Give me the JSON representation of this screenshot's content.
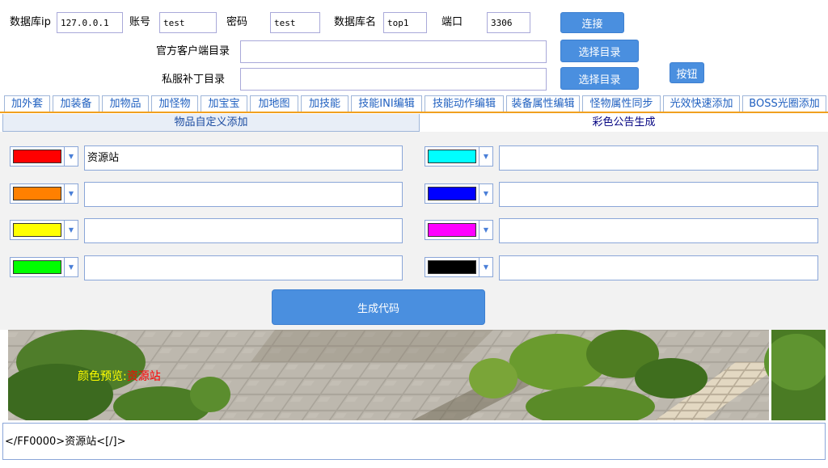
{
  "db": {
    "ip_label": "数据库ip",
    "ip_value": "127.0.0.1",
    "account_label": "账号",
    "account_value": "test",
    "password_label": "密码",
    "password_value": "test",
    "dbname_label": "数据库名",
    "dbname_value": "top1",
    "port_label": "端口",
    "port_value": "3306",
    "connect_button": "连接"
  },
  "dirs": {
    "official_label": "官方客户端目录",
    "official_value": "",
    "official_button": "选择目录",
    "private_label": "私服补丁目录",
    "private_value": "",
    "private_button": "选择目录",
    "extra_button": "按钮"
  },
  "tabs": [
    {
      "label": "加外套"
    },
    {
      "label": "加装备"
    },
    {
      "label": "加物品"
    },
    {
      "label": "加怪物"
    },
    {
      "label": "加宝宝"
    },
    {
      "label": "加地图"
    },
    {
      "label": "加技能"
    },
    {
      "label": "技能INI编辑"
    },
    {
      "label": "技能动作编辑"
    },
    {
      "label": "装备属性编辑"
    },
    {
      "label": "怪物属性同步"
    },
    {
      "label": "光效快速添加"
    },
    {
      "label": "BOSS光圈添加"
    }
  ],
  "subtabs": {
    "left": "物品自定义添加",
    "right": "彩色公告生成"
  },
  "colors": {
    "left": [
      {
        "color": "#ff0000",
        "text": "资源站"
      },
      {
        "color": "#ff8000",
        "text": ""
      },
      {
        "color": "#ffff00",
        "text": ""
      },
      {
        "color": "#00ff00",
        "text": ""
      }
    ],
    "right": [
      {
        "color": "#00ffff",
        "text": ""
      },
      {
        "color": "#0000ff",
        "text": ""
      },
      {
        "color": "#ff00ff",
        "text": ""
      },
      {
        "color": "#000000",
        "text": ""
      }
    ]
  },
  "generate_button": "生成代码",
  "preview": {
    "label": "颜色预览:",
    "text": "资源站",
    "label_color": "#ffff00",
    "text_color": "#ff0000"
  },
  "output": "</FF0000>资源站<[/]>"
}
